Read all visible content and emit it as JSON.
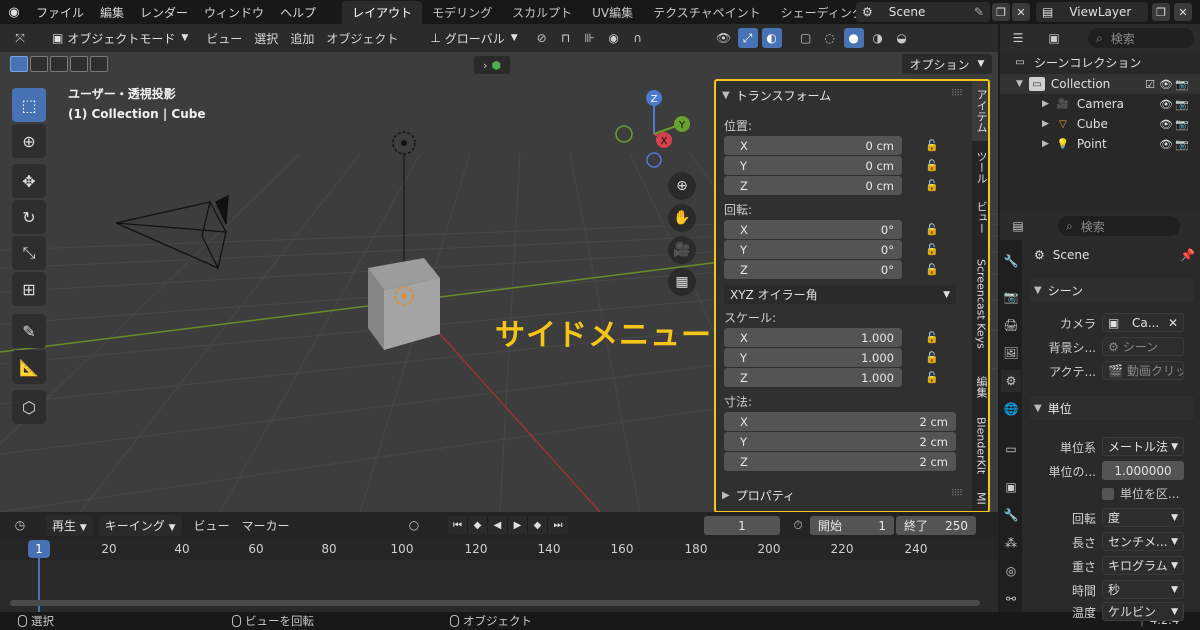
{
  "topbar": {
    "menus": [
      "ファイル",
      "編集",
      "レンダー",
      "ウィンドウ",
      "ヘルプ"
    ],
    "workspaces": [
      {
        "label": "レイアウト",
        "active": true
      },
      {
        "label": "モデリング",
        "active": false
      },
      {
        "label": "スカルプト",
        "active": false
      },
      {
        "label": "UV編集",
        "active": false
      },
      {
        "label": "テクスチャペイント",
        "active": false
      },
      {
        "label": "シェーディング",
        "active": false
      }
    ],
    "scene_name": "Scene",
    "view_layer": "ViewLayer"
  },
  "viewport": {
    "mode": "オブジェクトモード",
    "menus": [
      "ビュー",
      "選択",
      "追加",
      "オブジェクト"
    ],
    "transform_orientation": "グローバル",
    "options_label": "オプション",
    "info_line1": "ユーザー・透視投影",
    "info_line2": "(1) Collection | Cube",
    "gizmo": {
      "x": "X",
      "y": "Y",
      "z": "Z"
    },
    "annotation": "サイドメニュー"
  },
  "side_panel": {
    "transform_title": "トランスフォーム",
    "location_label": "位置:",
    "location": [
      {
        "axis": "X",
        "value": "0 cm"
      },
      {
        "axis": "Y",
        "value": "0 cm"
      },
      {
        "axis": "Z",
        "value": "0 cm"
      }
    ],
    "rotation_label": "回転:",
    "rotation": [
      {
        "axis": "X",
        "value": "0°"
      },
      {
        "axis": "Y",
        "value": "0°"
      },
      {
        "axis": "Z",
        "value": "0°"
      }
    ],
    "rotation_mode": "XYZ オイラー角",
    "scale_label": "スケール:",
    "scale": [
      {
        "axis": "X",
        "value": "1.000"
      },
      {
        "axis": "Y",
        "value": "1.000"
      },
      {
        "axis": "Z",
        "value": "1.000"
      }
    ],
    "dimensions_label": "寸法:",
    "dimensions": [
      {
        "axis": "X",
        "value": "2 cm"
      },
      {
        "axis": "Y",
        "value": "2 cm"
      },
      {
        "axis": "Z",
        "value": "2 cm"
      }
    ],
    "properties_title": "プロパティ",
    "tabs": [
      "アイテム",
      "ツール",
      "ビュー",
      "Screencast Keys",
      "編集",
      "BlenderKit",
      "MI"
    ]
  },
  "timeline": {
    "menus": [
      "再生",
      "キーイング",
      "ビュー",
      "マーカー"
    ],
    "current_frame": "1",
    "start_label": "開始",
    "start": "1",
    "end_label": "終了",
    "end": "250",
    "ruler": [
      "1",
      "20",
      "40",
      "60",
      "80",
      "100",
      "120",
      "140",
      "160",
      "180",
      "200",
      "220",
      "240"
    ]
  },
  "statusbar": {
    "select": "選択",
    "rotate_view": "ビューを回転",
    "object": "オブジェクト",
    "version": "4.2.4"
  },
  "outliner": {
    "search_placeholder": "検索",
    "root": "シーンコレクション",
    "collection": "Collection",
    "items": [
      "Camera",
      "Cube",
      "Point"
    ]
  },
  "properties": {
    "search_placeholder": "検索",
    "scene_label": "Scene",
    "scene_section": "シーン",
    "camera_label": "カメラ",
    "camera_value": "Ca...",
    "background_label": "背景シ...",
    "background_value": "シーン",
    "active_label": "アクテ...",
    "active_value": "動画クリッ",
    "units_section": "単位",
    "unit_system_label": "単位系",
    "unit_system": "メートル法",
    "unit_scale_label": "単位の...",
    "unit_scale": "1.000000",
    "separate_units": "単位を区...",
    "rotation_label": "回転",
    "rotation_unit": "度",
    "length_label": "長さ",
    "length_unit": "センチメ...",
    "mass_label": "重さ",
    "mass_unit": "キログラム",
    "time_label": "時間",
    "time_unit": "秒",
    "temp_label": "温度",
    "temp_unit": "ケルビン"
  }
}
